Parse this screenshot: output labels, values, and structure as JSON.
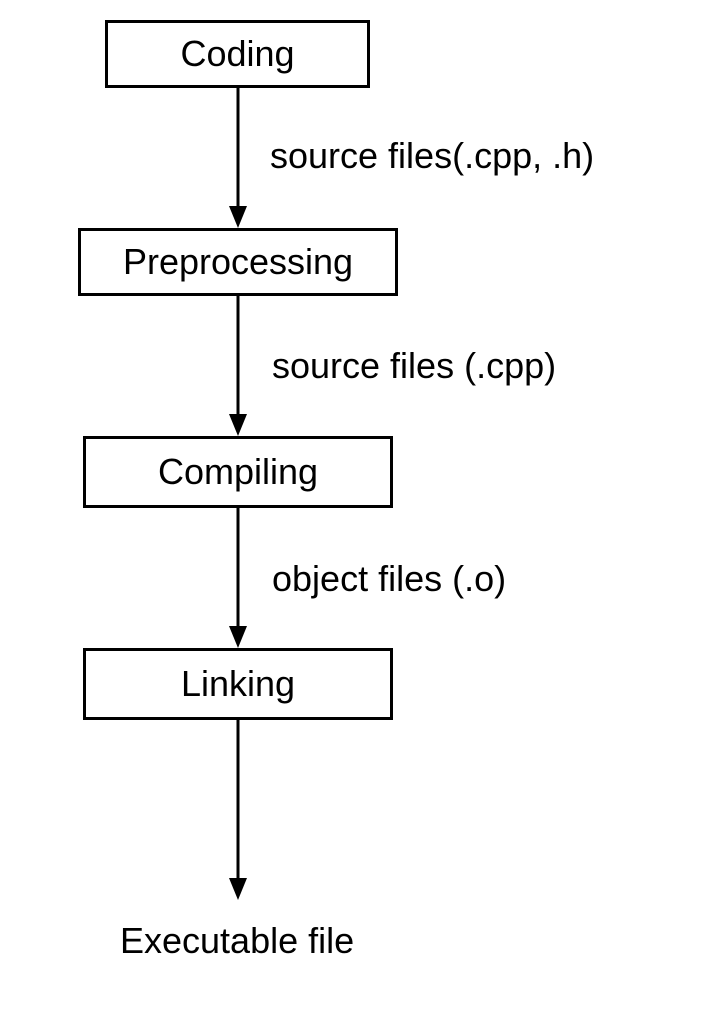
{
  "boxes": {
    "coding": "Coding",
    "preprocessing": "Preprocessing",
    "compiling": "Compiling",
    "linking": "Linking"
  },
  "edges": {
    "coding_to_preprocessing": "source files(.cpp, .h)",
    "preprocessing_to_compiling": "source files (.cpp)",
    "compiling_to_linking": "object files (.o)"
  },
  "final": "Executable file"
}
